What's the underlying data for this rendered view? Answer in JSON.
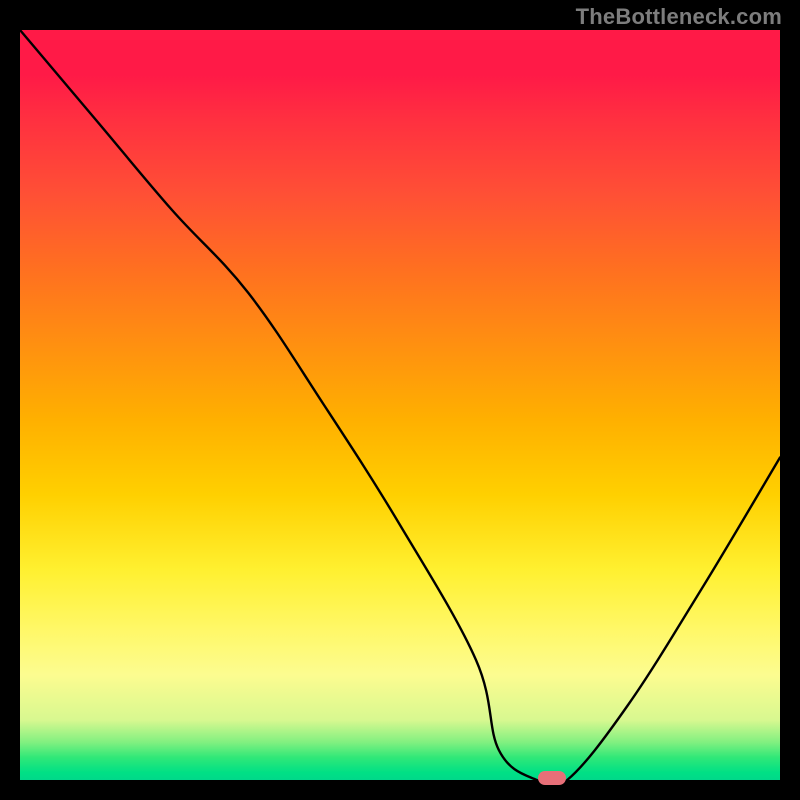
{
  "watermark": "TheBottleneck.com",
  "chart_data": {
    "type": "line",
    "title": "",
    "xlabel": "",
    "ylabel": "",
    "xlim": [
      0,
      100
    ],
    "ylim": [
      0,
      100
    ],
    "x": [
      0,
      10,
      20,
      30,
      40,
      50,
      60,
      63,
      68,
      72,
      80,
      90,
      100
    ],
    "values": [
      100,
      88,
      76,
      65,
      50,
      34,
      16,
      4,
      0,
      0,
      10,
      26,
      43
    ],
    "marker": {
      "x": 70,
      "y": 0
    },
    "background": "rainbow-vertical-gradient",
    "colors": {
      "top": "#ff1a47",
      "mid": "#ffd000",
      "bottom": "#00d88a",
      "line": "#000000",
      "marker": "#e76f78"
    }
  }
}
